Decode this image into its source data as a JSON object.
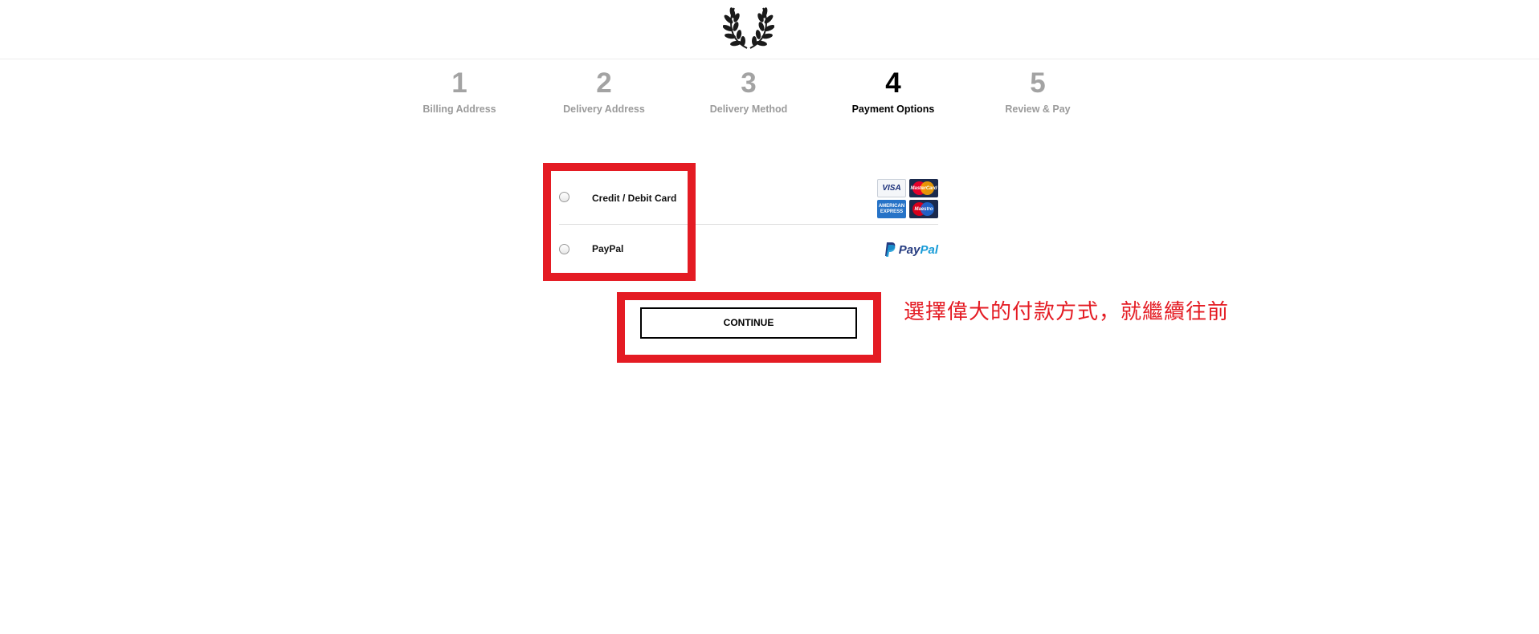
{
  "header": {
    "logo_icon": "laurel-wreath-icon"
  },
  "steps": [
    {
      "number": "1",
      "label": "Billing Address",
      "active": false
    },
    {
      "number": "2",
      "label": "Delivery Address",
      "active": false
    },
    {
      "number": "3",
      "label": "Delivery Method",
      "active": false
    },
    {
      "number": "4",
      "label": "Payment Options",
      "active": true
    },
    {
      "number": "5",
      "label": "Review & Pay",
      "active": false
    }
  ],
  "payment_options": [
    {
      "label": "Credit / Debit Card",
      "selected": false,
      "logos": [
        "VISA",
        "MasterCard",
        "AMERICAN EXPRESS",
        "Maestro"
      ]
    },
    {
      "label": "PayPal",
      "selected": false,
      "logo_text_pay": "Pay",
      "logo_text_pal": "Pal"
    }
  ],
  "continue_label": "CONTINUE",
  "annotation_text": "選擇偉大的付款方式，就繼續往前",
  "colors": {
    "highlight": "#e41b23",
    "active_step": "#000000",
    "inactive_step": "#a3a3a3"
  }
}
